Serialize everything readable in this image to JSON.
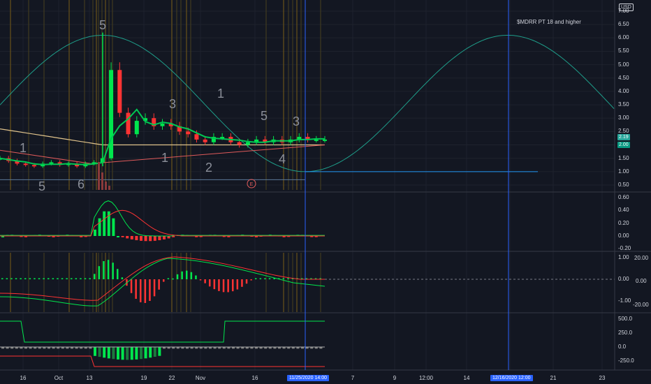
{
  "currency": "USD",
  "annotation": "$MDRR PT 18 and higher",
  "price_axis": [
    "7.00",
    "6.50",
    "6.00",
    "5.50",
    "5.00",
    "4.50",
    "4.00",
    "3.50",
    "3.00",
    "2.50",
    "2.00",
    "1.50",
    "1.00",
    "0.50"
  ],
  "current_price": "2.19",
  "current_price_2": "2.00",
  "pane2_axis": [
    "0.60",
    "0.40",
    "0.20",
    "0.00",
    "-0.20"
  ],
  "pane3_axis_left": [
    "1.00",
    "0.00",
    "-1.00"
  ],
  "pane3_axis_right": [
    "20.00",
    "0.00",
    "-20.00"
  ],
  "pane4_axis": [
    "500.0",
    "250.0",
    "0.0",
    "-250.0"
  ],
  "x_labels": [
    "16",
    "Oct",
    "13",
    "19",
    "22",
    "Nov",
    "16",
    "7",
    "9",
    "12:00",
    "14",
    "18",
    "21",
    "23"
  ],
  "crosshair_date_1": "11/25/2020",
  "crosshair_time_1": "14:00",
  "crosshair_date_2": "12/16/2020",
  "crosshair_time_2": "12:00",
  "earnings_marker": "E",
  "wave_labels": [
    "1",
    "5",
    "6",
    "5",
    "1",
    "3",
    "2",
    "1",
    "5",
    "4",
    "3"
  ],
  "colors": {
    "background": "#131722",
    "up": "#00e64d",
    "down": "#ff3333",
    "cycle": "#1e9e8a",
    "crosshair": "#2962ff",
    "grid": "#1e222d"
  },
  "chart_data": {
    "type": "line",
    "title": "",
    "ylabel": "USD",
    "ylim": [
      0.3,
      7.0
    ],
    "series": [
      {
        "values": [
          1.5,
          1.4,
          1.3,
          1.25,
          1.2,
          1.3,
          1.35,
          1.25,
          1.3,
          1.2,
          1.3,
          1.35,
          1.5,
          4.8,
          3.2,
          2.4,
          2.9,
          3.0,
          2.7,
          2.8,
          2.7,
          2.5,
          2.4,
          2.2,
          2.1,
          2.3,
          2.3,
          2.1,
          2.0,
          2.1,
          2.2,
          2.1,
          2.2,
          2.1,
          2.2,
          2.3,
          2.2,
          2.2,
          2.2
        ]
      },
      {
        "values": [
          2.6,
          2.55,
          2.5,
          2.45,
          2.4,
          2.35,
          2.3,
          2.25,
          2.2,
          2.15,
          2.1,
          2.05,
          2.0,
          2.0,
          2.0,
          2.0,
          2.0,
          2.0,
          2.0,
          2.0,
          2.0,
          2.0,
          2.0,
          2.0,
          2.0,
          2.0,
          2.0,
          2.0,
          2.0,
          2.0,
          2.0,
          2.0,
          2.0,
          2.0,
          2.0,
          2.0,
          2.0,
          2.0,
          2.0
        ]
      }
    ],
    "cycle_peak": 6.1,
    "cycle_trough": 1.0,
    "grid": true
  }
}
